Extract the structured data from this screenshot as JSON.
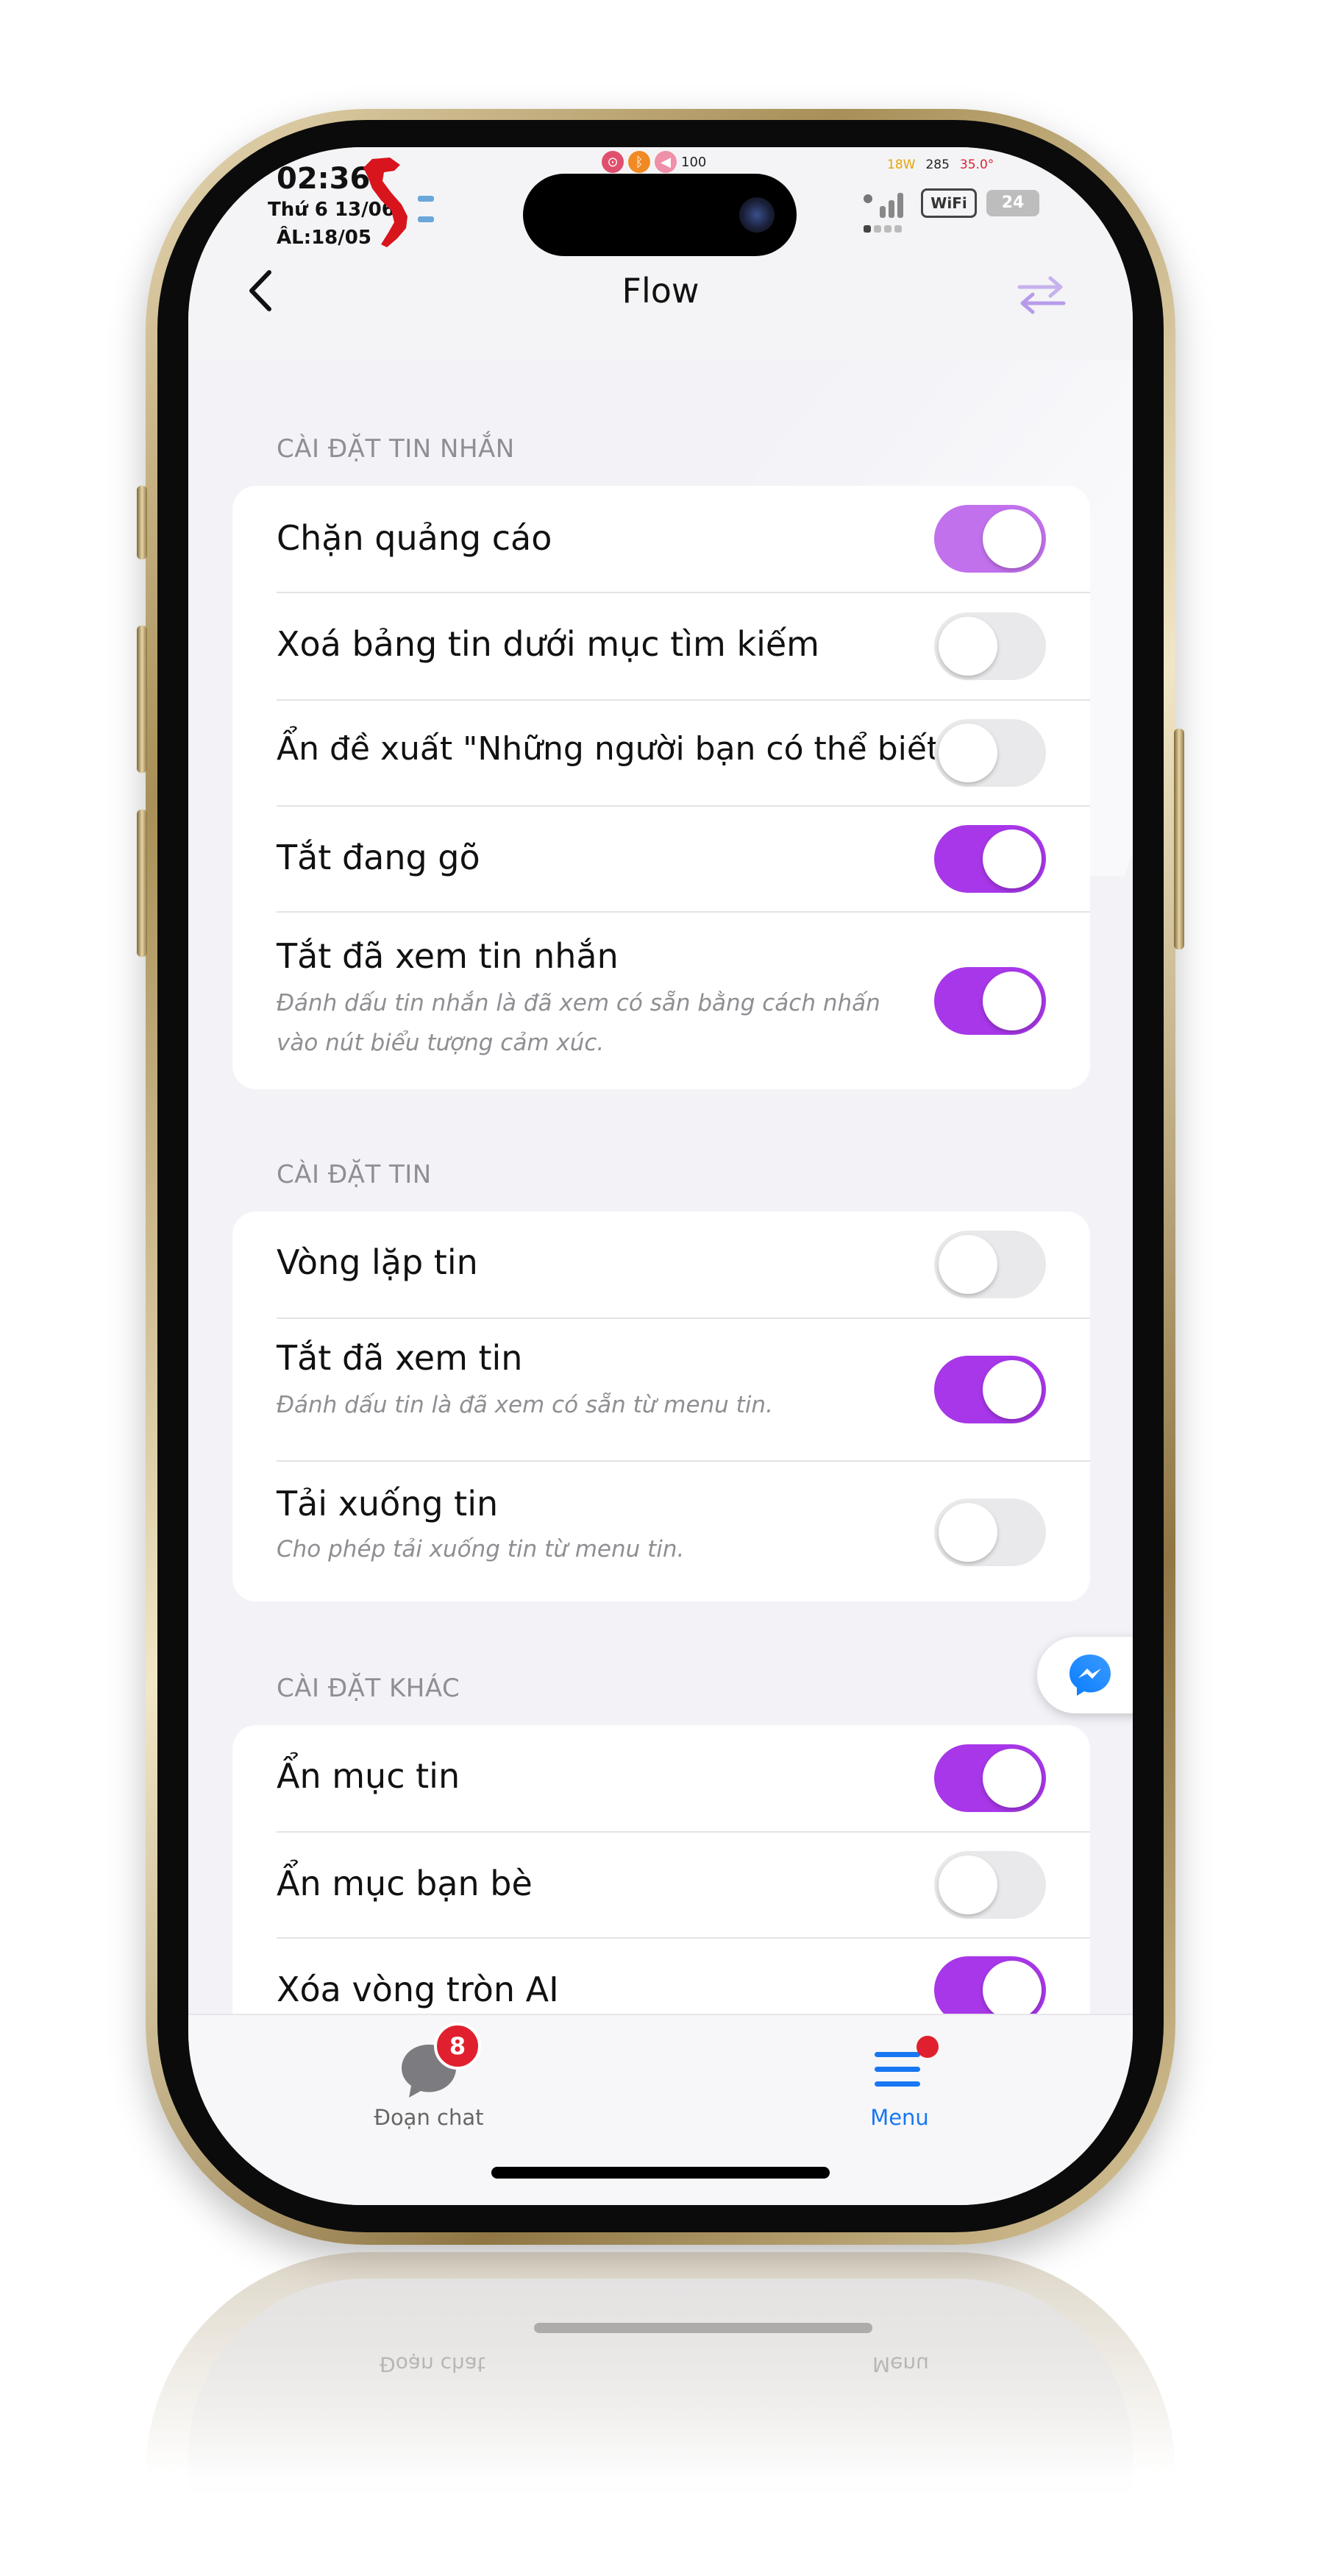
{
  "status_bar": {
    "time": "02:36",
    "date": "Thứ 6 13/06",
    "lunar_date": "ÂL:18/05",
    "battery_percent": "100",
    "power": "18W",
    "net": "285",
    "temp": "35.0°",
    "wifi": "WiFi",
    "battery_alt": "24"
  },
  "nav": {
    "title": "Flow",
    "back_icon": "chevron-left-icon",
    "swap_icon": "swap-arrows-icon"
  },
  "sections": [
    {
      "title": "CÀI ĐẶT TIN NHẮN",
      "rows": [
        {
          "label": "Chặn quảng cáo",
          "on": true
        },
        {
          "label": "Xoá bảng tin dưới mục tìm kiếm",
          "on": false
        },
        {
          "label": "Ẩn đề xuất \"Những người bạn có thể biết\"",
          "on": false
        },
        {
          "label": "Tắt đang gõ",
          "on": true
        },
        {
          "label": "Tắt đã xem tin nhắn",
          "on": true,
          "desc": "Đánh dấu tin nhắn là đã xem có sẵn bằng cách nhấn vào nút biểu tượng cảm xúc."
        }
      ]
    },
    {
      "title": "CÀI ĐẶT TIN",
      "rows": [
        {
          "label": "Vòng lặp tin",
          "on": false
        },
        {
          "label": "Tắt đã xem tin",
          "on": true,
          "desc": "Đánh dấu tin là đã xem có sẵn từ menu tin."
        },
        {
          "label": "Tải xuống tin",
          "on": false,
          "desc": "Cho phép tải xuống tin từ menu tin."
        }
      ]
    },
    {
      "title": "CÀI ĐẶT KHÁC",
      "rows": [
        {
          "label": "Ẩn mục tin",
          "on": true
        },
        {
          "label": "Ẩn mục bạn bè",
          "on": false
        },
        {
          "label": "Xóa vòng tròn AI",
          "on": true
        }
      ]
    }
  ],
  "tabbar": {
    "chats_label": "Đoạn chat",
    "chats_badge": "8",
    "menu_label": "Menu"
  },
  "colors": {
    "accent": "#a737e8",
    "accent_light": "#c271ec",
    "menu_blue": "#1877f2",
    "badge_red": "#e0202e"
  },
  "fab_icon": "messenger-icon"
}
